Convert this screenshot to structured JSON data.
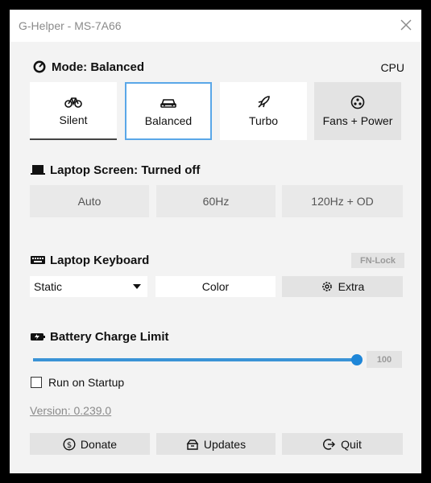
{
  "window": {
    "title": "G-Helper - MS-7A66"
  },
  "mode": {
    "title": "Mode: Balanced",
    "cpu_label": "CPU",
    "buttons": [
      {
        "label": "Silent",
        "icon": "bicycle-icon"
      },
      {
        "label": "Balanced",
        "icon": "car-icon"
      },
      {
        "label": "Turbo",
        "icon": "rocket-icon"
      },
      {
        "label": "Fans + Power",
        "icon": "fan-icon"
      }
    ],
    "selected": "Balanced"
  },
  "screen": {
    "title": "Laptop Screen: Turned off",
    "buttons": [
      "Auto",
      "60Hz",
      "120Hz + OD"
    ]
  },
  "keyboard": {
    "title": "Laptop Keyboard",
    "fn_lock_label": "FN-Lock",
    "mode_selected": "Static",
    "color_label": "Color",
    "extra_label": "Extra"
  },
  "battery": {
    "title": "Battery Charge Limit",
    "limit_value": "100",
    "limit_fraction": 1.0
  },
  "startup": {
    "label": "Run on Startup",
    "checked": false
  },
  "version": {
    "label": "Version: 0.239.0"
  },
  "footer": {
    "donate_label": "Donate",
    "updates_label": "Updates",
    "quit_label": "Quit"
  },
  "colors": {
    "accent": "#1e86d8",
    "selected_border": "#5aa7e8",
    "background": "#f3f3f3"
  }
}
